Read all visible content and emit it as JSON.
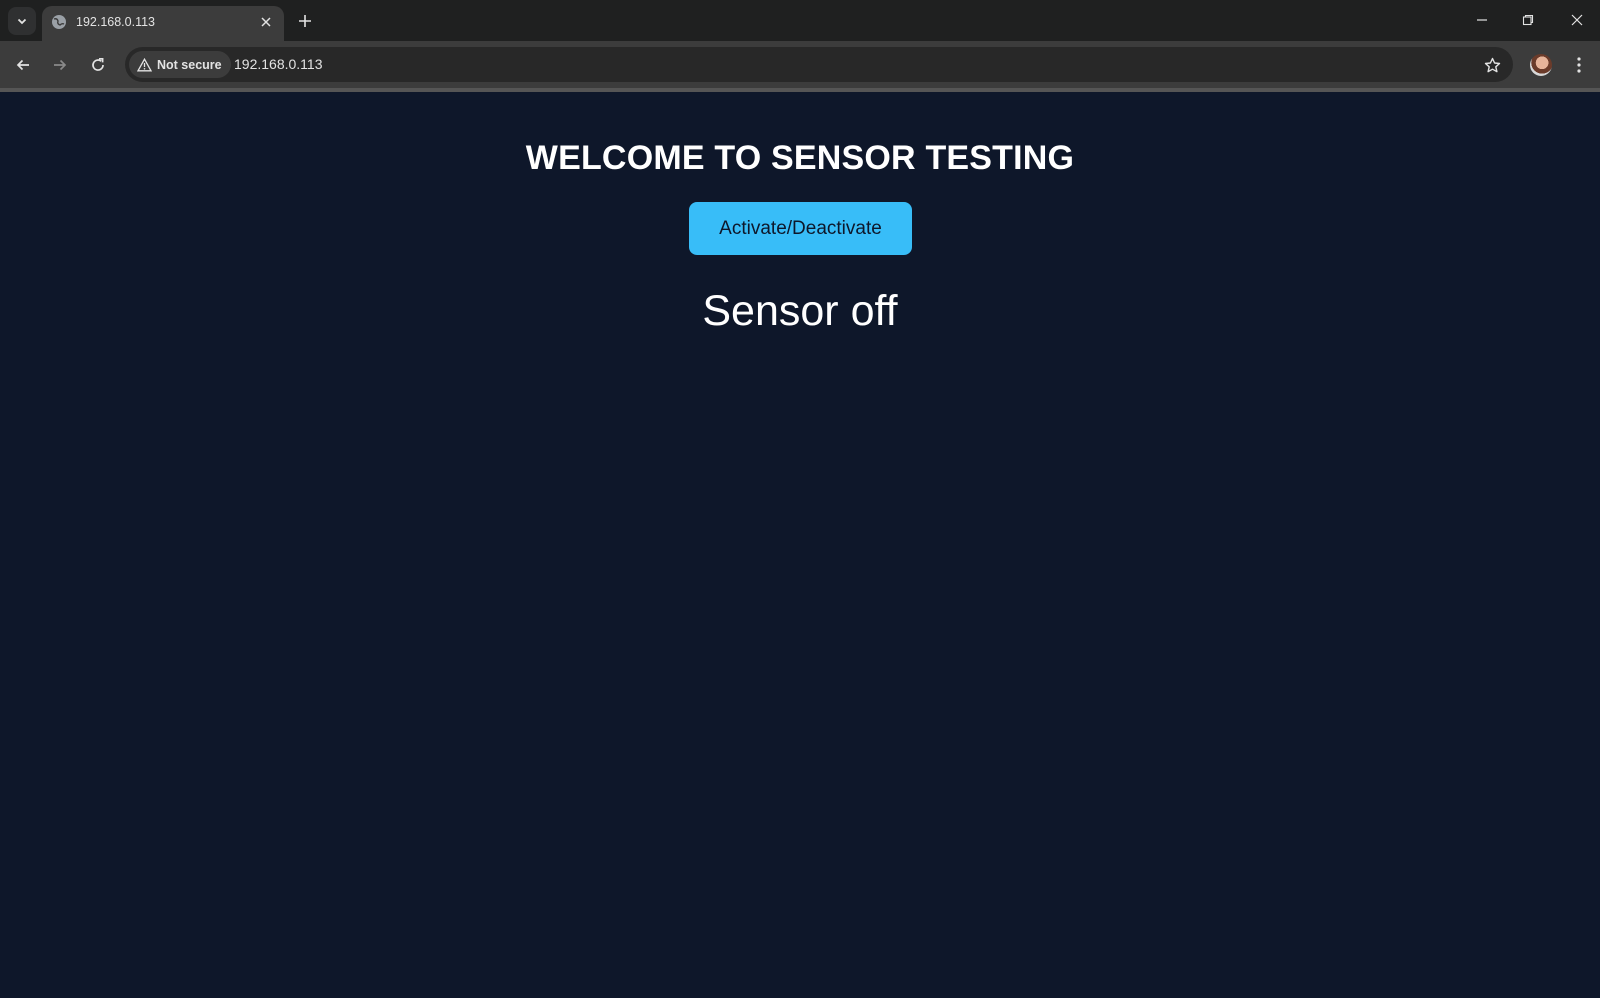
{
  "browser": {
    "tab": {
      "title": "192.168.0.113"
    },
    "security": {
      "label": "Not secure"
    },
    "address": {
      "url": "192.168.0.113"
    }
  },
  "page": {
    "heading": "WELCOME TO SENSOR TESTING",
    "button_label": "Activate/Deactivate",
    "status": "Sensor off"
  },
  "colors": {
    "page_background": "#0e172a",
    "button_accent": "#38bdf8",
    "chrome_dark": "#1f2020",
    "chrome_toolbar": "#3c3c3c"
  },
  "icons": [
    "tab-list-icon",
    "globe-icon",
    "close-icon",
    "plus-icon",
    "minimize-icon",
    "restore-icon",
    "window-close-icon",
    "back-arrow-icon",
    "forward-arrow-icon",
    "reload-icon",
    "warning-icon",
    "star-icon",
    "kebab-menu-icon"
  ]
}
